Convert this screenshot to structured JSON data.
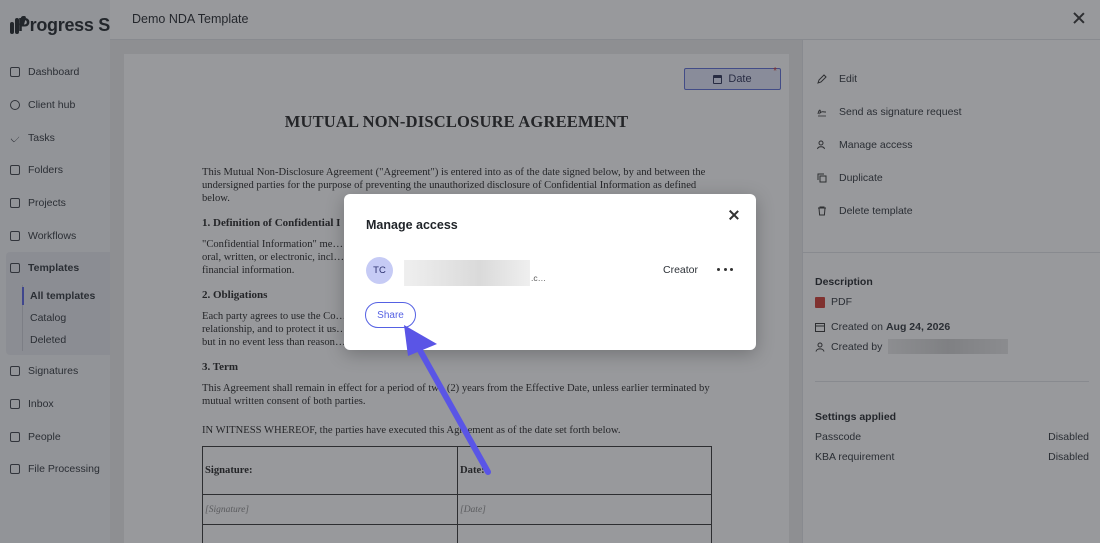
{
  "brand": {
    "name": "Progress S"
  },
  "sidebar": {
    "items": [
      {
        "label": "Dashboard"
      },
      {
        "label": "Client hub"
      },
      {
        "label": "Tasks"
      },
      {
        "label": "Folders"
      },
      {
        "label": "Projects"
      },
      {
        "label": "Workflows"
      }
    ],
    "templates": {
      "label": "Templates",
      "subitems": [
        {
          "label": "All templates"
        },
        {
          "label": "Catalog"
        },
        {
          "label": "Deleted"
        }
      ]
    },
    "items_after": [
      {
        "label": "Signatures"
      },
      {
        "label": "Inbox"
      },
      {
        "label": "People"
      },
      {
        "label": "File Processing"
      }
    ]
  },
  "panel": {
    "title": "Demo NDA Template"
  },
  "document": {
    "date_field_label": "Date",
    "date_field_required": "*",
    "heading": "MUTUAL NON-DISCLOSURE AGREEMENT",
    "intro": "This Mutual Non-Disclosure Agreement (\"Agreement\") is entered into as of the date signed below, by and between the undersigned parties for the purpose of preventing the unauthorized disclosure of Confidential Information as defined below.",
    "s1_title": "1. Definition of Confidential I",
    "s1_text": "\"Confidential Information\" me… oral, written, or electronic, incl… financial information.",
    "s2_title": "2. Obligations",
    "s2_text": "Each party agrees to use the Co… relationship, and to protect it us… but in no event less than reason…",
    "s3_title": "3. Term",
    "s3_text": "This Agreement shall remain in effect for a period of two (2) years from the Effective Date, unless earlier terminated by mutual written consent of both parties.",
    "witness": "IN WITNESS WHEREOF, the parties have executed this Agreement as of the date set forth below.",
    "table": {
      "headers": [
        "Signature:",
        "Date:"
      ],
      "placeholders": [
        "[Signature]",
        "[Date]"
      ]
    }
  },
  "actions": [
    {
      "label": "Edit",
      "icon": "pencil-icon"
    },
    {
      "label": "Send as signature request",
      "icon": "signature-icon"
    },
    {
      "label": "Manage access",
      "icon": "users-icon"
    },
    {
      "label": "Duplicate",
      "icon": "duplicate-icon"
    },
    {
      "label": "Delete template",
      "icon": "trash-icon"
    }
  ],
  "description": {
    "title": "Description",
    "file_type": "PDF",
    "created_on_prefix": "Created on",
    "created_on_date": "Aug 24, 2026",
    "created_by_prefix": "Created by"
  },
  "settings": {
    "title": "Settings applied",
    "rows": [
      {
        "label": "Passcode",
        "value": "Disabled"
      },
      {
        "label": "KBA requirement",
        "value": "Disabled"
      }
    ]
  },
  "modal": {
    "title": "Manage access",
    "user_initials": "TC",
    "user_email_tail": ".c…",
    "user_role": "Creator",
    "share_label": "Share"
  },
  "colors": {
    "accent": "#5561e3",
    "overlay": "rgba(40,42,48,0.48)",
    "pdf": "#d13b30",
    "arrow": "#5a55e6"
  }
}
